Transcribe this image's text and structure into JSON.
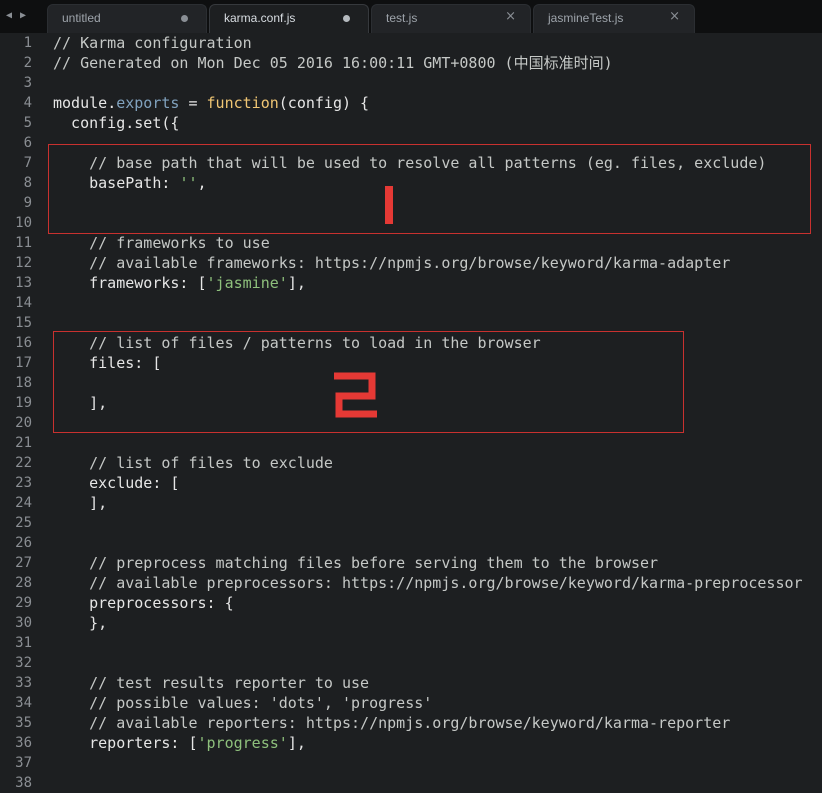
{
  "nav": {
    "back_glyph": "◀",
    "forward_glyph": "▶"
  },
  "tabs": [
    {
      "label": "untitled",
      "state": "modified"
    },
    {
      "label": "karma.conf.js",
      "state": "modified",
      "active": true
    },
    {
      "label": "test.js",
      "state": "close"
    },
    {
      "label": "jasmineTest.js",
      "state": "close"
    }
  ],
  "close_glyph": "×",
  "lines": [
    {
      "n": "1",
      "segs": [
        {
          "t": "// Karma configuration",
          "c": "cmt"
        }
      ]
    },
    {
      "n": "2",
      "segs": [
        {
          "t": "// Generated on Mon Dec 05 2016 16:00:11 GMT+0800 (中国标准时间)",
          "c": "cmt"
        }
      ]
    },
    {
      "n": "3",
      "segs": []
    },
    {
      "n": "4",
      "segs": [
        {
          "t": "module",
          "c": ""
        },
        {
          "t": ".",
          "c": ""
        },
        {
          "t": "exports",
          "c": "prop"
        },
        {
          "t": " = ",
          "c": ""
        },
        {
          "t": "function",
          "c": "kw"
        },
        {
          "t": "(config) {",
          "c": ""
        }
      ]
    },
    {
      "n": "5",
      "segs": [
        {
          "t": "  config.set({",
          "c": ""
        }
      ]
    },
    {
      "n": "6",
      "segs": []
    },
    {
      "n": "7",
      "segs": [
        {
          "t": "    // base path that will be used to resolve all patterns (eg. files, exclude)",
          "c": "cmt"
        }
      ]
    },
    {
      "n": "8",
      "segs": [
        {
          "t": "    basePath: ",
          "c": ""
        },
        {
          "t": "''",
          "c": "str"
        },
        {
          "t": ",",
          "c": ""
        }
      ]
    },
    {
      "n": "9",
      "segs": []
    },
    {
      "n": "10",
      "segs": []
    },
    {
      "n": "11",
      "segs": [
        {
          "t": "    // frameworks to use",
          "c": "cmt"
        }
      ]
    },
    {
      "n": "12",
      "segs": [
        {
          "t": "    // available frameworks: https://npmjs.org/browse/keyword/karma-adapter",
          "c": "cmt"
        }
      ]
    },
    {
      "n": "13",
      "segs": [
        {
          "t": "    frameworks: [",
          "c": ""
        },
        {
          "t": "'jasmine'",
          "c": "str"
        },
        {
          "t": "],",
          "c": ""
        }
      ]
    },
    {
      "n": "14",
      "segs": []
    },
    {
      "n": "15",
      "segs": []
    },
    {
      "n": "16",
      "segs": [
        {
          "t": "    // list of files / patterns to load in the browser",
          "c": "cmt"
        }
      ]
    },
    {
      "n": "17",
      "segs": [
        {
          "t": "    files: [",
          "c": ""
        }
      ]
    },
    {
      "n": "18",
      "segs": []
    },
    {
      "n": "19",
      "segs": [
        {
          "t": "    ],",
          "c": ""
        }
      ]
    },
    {
      "n": "20",
      "segs": []
    },
    {
      "n": "21",
      "segs": []
    },
    {
      "n": "22",
      "segs": [
        {
          "t": "    // list of files to exclude",
          "c": "cmt"
        }
      ]
    },
    {
      "n": "23",
      "segs": [
        {
          "t": "    exclude: [",
          "c": ""
        }
      ]
    },
    {
      "n": "24",
      "segs": [
        {
          "t": "    ],",
          "c": ""
        }
      ]
    },
    {
      "n": "25",
      "segs": []
    },
    {
      "n": "26",
      "segs": []
    },
    {
      "n": "27",
      "segs": [
        {
          "t": "    // preprocess matching files before serving them to the browser",
          "c": "cmt"
        }
      ]
    },
    {
      "n": "28",
      "segs": [
        {
          "t": "    // available preprocessors: https://npmjs.org/browse/keyword/karma-preprocessor",
          "c": "cmt"
        }
      ]
    },
    {
      "n": "29",
      "segs": [
        {
          "t": "    preprocessors: {",
          "c": ""
        }
      ]
    },
    {
      "n": "30",
      "segs": [
        {
          "t": "    },",
          "c": ""
        }
      ]
    },
    {
      "n": "31",
      "segs": []
    },
    {
      "n": "32",
      "segs": []
    },
    {
      "n": "33",
      "segs": [
        {
          "t": "    // test results reporter to use",
          "c": "cmt"
        }
      ]
    },
    {
      "n": "34",
      "segs": [
        {
          "t": "    // possible values: 'dots', 'progress'",
          "c": "cmt"
        }
      ]
    },
    {
      "n": "35",
      "segs": [
        {
          "t": "    // available reporters: https://npmjs.org/browse/keyword/karma-reporter",
          "c": "cmt"
        }
      ]
    },
    {
      "n": "36",
      "segs": [
        {
          "t": "    reporters: [",
          "c": ""
        },
        {
          "t": "'progress'",
          "c": "str"
        },
        {
          "t": "],",
          "c": ""
        }
      ]
    },
    {
      "n": "37",
      "segs": []
    },
    {
      "n": "38",
      "segs": []
    }
  ],
  "annotation_color": "#e53935"
}
